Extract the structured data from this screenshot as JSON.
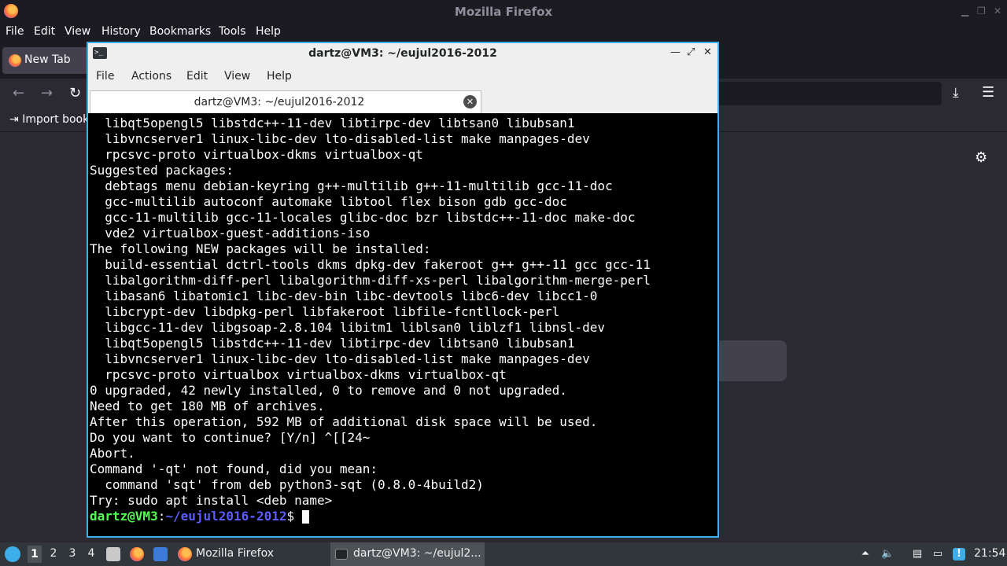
{
  "firefox": {
    "window_title": "Mozilla Firefox",
    "menu": [
      "File",
      "Edit",
      "View",
      "History",
      "Bookmarks",
      "Tools",
      "Help"
    ],
    "tab_label": "New Tab",
    "bookmarks_import": "Import book"
  },
  "terminal": {
    "window_title": "dartz@VM3: ~/eujul2016-2012",
    "menu": [
      "File",
      "Actions",
      "Edit",
      "View",
      "Help"
    ],
    "tab_label": "dartz@VM3: ~/eujul2016-2012",
    "lines": [
      "  libqt5opengl5 libstdc++-11-dev libtirpc-dev libtsan0 libubsan1",
      "  libvncserver1 linux-libc-dev lto-disabled-list make manpages-dev",
      "  rpcsvc-proto virtualbox-dkms virtualbox-qt",
      "Suggested packages:",
      "  debtags menu debian-keyring g++-multilib g++-11-multilib gcc-11-doc",
      "  gcc-multilib autoconf automake libtool flex bison gdb gcc-doc",
      "  gcc-11-multilib gcc-11-locales glibc-doc bzr libstdc++-11-doc make-doc",
      "  vde2 virtualbox-guest-additions-iso",
      "The following NEW packages will be installed:",
      "  build-essential dctrl-tools dkms dpkg-dev fakeroot g++ g++-11 gcc gcc-11",
      "  libalgorithm-diff-perl libalgorithm-diff-xs-perl libalgorithm-merge-perl",
      "  libasan6 libatomic1 libc-dev-bin libc-devtools libc6-dev libcc1-0",
      "  libcrypt-dev libdpkg-perl libfakeroot libfile-fcntllock-perl",
      "  libgcc-11-dev libgsoap-2.8.104 libitm1 liblsan0 liblzf1 libnsl-dev",
      "  libqt5opengl5 libstdc++-11-dev libtirpc-dev libtsan0 libubsan1",
      "  libvncserver1 linux-libc-dev lto-disabled-list make manpages-dev",
      "  rpcsvc-proto virtualbox virtualbox-dkms virtualbox-qt",
      "0 upgraded, 42 newly installed, 0 to remove and 0 not upgraded.",
      "Need to get 180 MB of archives.",
      "After this operation, 592 MB of additional disk space will be used.",
      "Do you want to continue? [Y/n] ^[[24~",
      "Abort.",
      "Command '-qt' not found, did you mean:",
      "  command 'sqt' from deb python3-sqt (0.8.0-4build2)",
      "Try: sudo apt install <deb name>"
    ],
    "prompt_user": "dartz@VM3",
    "prompt_sep": ":",
    "prompt_path": "~/eujul2016-2012",
    "prompt_symbol": "$ "
  },
  "taskbar": {
    "workspaces": [
      "1",
      "2",
      "3",
      "4"
    ],
    "active_workspace": "1",
    "tasks": [
      "Mozilla Firefox",
      "dartz@VM3: ~/eujul2..."
    ],
    "clock": "21:54"
  },
  "colors": {
    "accent": "#3daee9",
    "prompt_user": "#54ff54",
    "prompt_path": "#5c5cff",
    "terminal_bg": "#000000"
  },
  "icons": [
    "firefox-icon",
    "terminal-icon",
    "close-icon",
    "minimize-icon",
    "maximize-icon",
    "back-icon",
    "forward-icon",
    "reload-icon",
    "download-icon",
    "menu-icon",
    "gear-icon",
    "volume-icon",
    "network-icon",
    "clipboard-icon"
  ]
}
